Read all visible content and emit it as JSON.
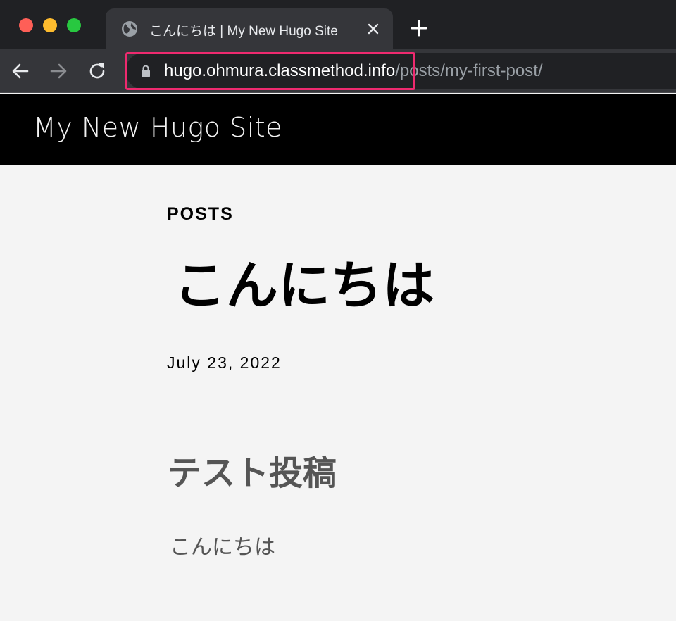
{
  "browser": {
    "tab": {
      "title": "こんにちは | My New Hugo Site",
      "favicon": "globe-icon"
    },
    "address_bar": {
      "host": "hugo.ohmura.classmethod.info",
      "path": "/posts/my-first-post/",
      "secure_icon": "lock-icon"
    },
    "highlight_color": "#ee2a6f"
  },
  "site": {
    "title": "My New Hugo Site"
  },
  "post": {
    "section": "POSTS",
    "title": "こんにちは",
    "date": "July 23, 2022",
    "heading": "テスト投稿",
    "body": "こんにちは"
  }
}
